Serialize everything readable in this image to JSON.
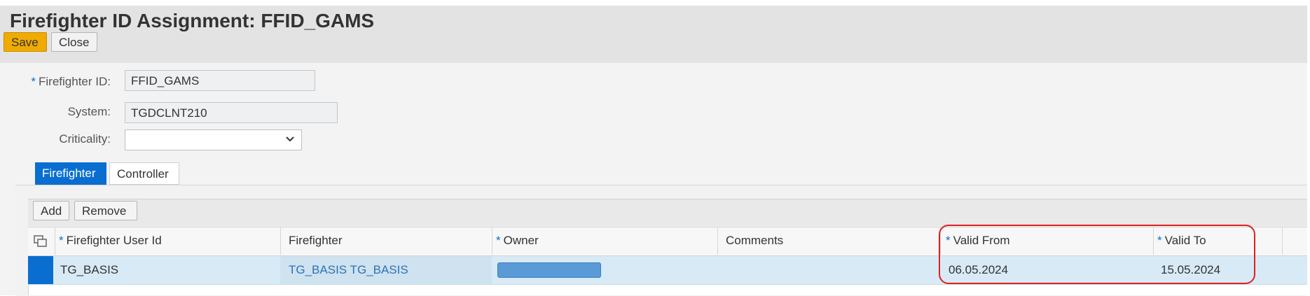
{
  "page": {
    "title": "Firefighter ID Assignment: FFID_GAMS"
  },
  "toolbar": {
    "save_label": "Save",
    "close_label": "Close"
  },
  "form": {
    "required_marker": "*",
    "firefighter_id_label": "Firefighter ID:",
    "firefighter_id_value": "FFID_GAMS",
    "system_label": "System:",
    "system_value": "TGDCLNT210",
    "criticality_label": "Criticality:",
    "criticality_value": ""
  },
  "tabs": [
    {
      "label": "Firefighter",
      "active": true
    },
    {
      "label": "Controller",
      "active": false
    }
  ],
  "table": {
    "add_label": "Add",
    "remove_label": "Remove",
    "columns": [
      "Firefighter User Id",
      "Firefighter",
      "Owner",
      "Comments",
      "Valid From",
      "Valid To"
    ],
    "rows": [
      {
        "user_id": "TG_BASIS",
        "firefighter": "TG_BASIS TG_BASIS",
        "owner": "",
        "comments": "",
        "valid_from": "06.05.2024",
        "valid_to": "15.05.2024"
      }
    ]
  },
  "icons": {
    "column_settings": "column-settings-icon",
    "dropdown": "chevron-down-icon"
  },
  "colors": {
    "accent": "#0a6ed1",
    "save_button": "#f0ab00",
    "selected_row": "#d8eaf5",
    "highlight": "#e02020"
  }
}
